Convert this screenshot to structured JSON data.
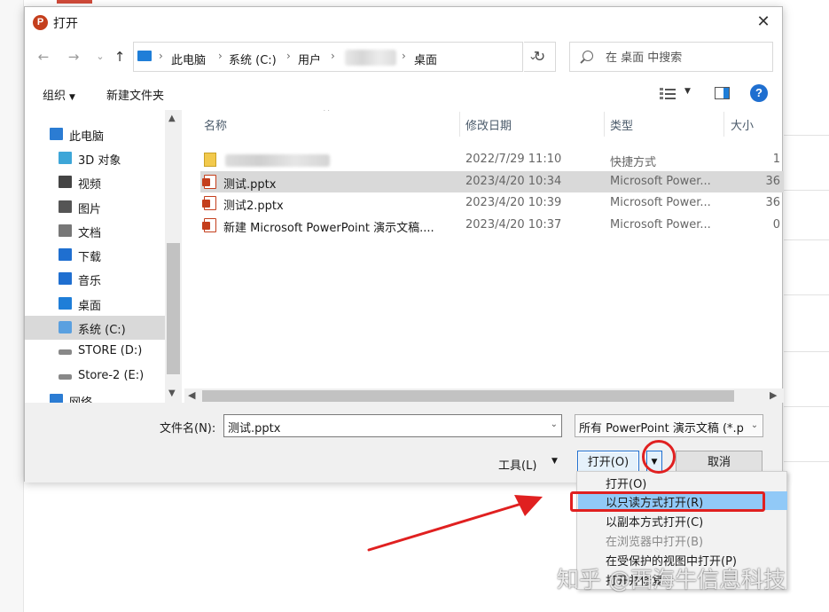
{
  "dialog": {
    "title": "打开",
    "app_icon_letter": "P",
    "close_glyph": "✕"
  },
  "nav_buttons": {
    "back": "←",
    "forward": "→",
    "recent": "⌄",
    "up": "↑"
  },
  "breadcrumb": [
    "此电脑",
    "系统 (C:)",
    "用户",
    "桌面"
  ],
  "search": {
    "placeholder": "在 桌面 中搜索"
  },
  "toolbar": {
    "organize": "组织",
    "new_folder": "新建文件夹",
    "help": "?"
  },
  "nav_pane": {
    "items": [
      {
        "label": "此电脑",
        "icon": "pc-icon",
        "color": "#2b7cd3"
      },
      {
        "label": "3D 对象",
        "icon": "cube-icon",
        "color": "#3da6d8"
      },
      {
        "label": "视频",
        "icon": "video-icon",
        "color": "#444444"
      },
      {
        "label": "图片",
        "icon": "picture-icon",
        "color": "#555555"
      },
      {
        "label": "文档",
        "icon": "document-icon",
        "color": "#777777"
      },
      {
        "label": "下载",
        "icon": "download-icon",
        "color": "#1f6fd0"
      },
      {
        "label": "音乐",
        "icon": "music-icon",
        "color": "#1f6fd0"
      },
      {
        "label": "桌面",
        "icon": "desktop-icon",
        "color": "#1f7ed8"
      },
      {
        "label": "系统 (C:)",
        "icon": "drive-c-icon",
        "color": "#5aa0e0"
      },
      {
        "label": "STORE (D:)",
        "icon": "drive-icon",
        "color": "#888888"
      },
      {
        "label": "Store-2 (E:)",
        "icon": "drive-icon",
        "color": "#888888"
      },
      {
        "label": "网络",
        "icon": "network-icon",
        "color": "#2b7cd3"
      }
    ],
    "selected": "系统 (C:)"
  },
  "file_list": {
    "columns": [
      "名称",
      "修改日期",
      "类型",
      "大小"
    ],
    "rows": [
      {
        "name": "",
        "date": "2022/7/29 11:10",
        "type": "快捷方式",
        "size": "1",
        "icon": "shortcut-icon",
        "selected": false
      },
      {
        "name": "测试.pptx",
        "date": "2023/4/20 10:34",
        "type": "Microsoft Power...",
        "size": "36",
        "icon": "ppt-icon",
        "selected": true
      },
      {
        "name": "测试2.pptx",
        "date": "2023/4/20 10:39",
        "type": "Microsoft Power...",
        "size": "36",
        "icon": "ppt-icon",
        "selected": false
      },
      {
        "name": "新建 Microsoft PowerPoint 演示文稿....",
        "date": "2023/4/20 10:37",
        "type": "Microsoft Power...",
        "size": "0",
        "icon": "ppt-icon",
        "selected": false
      }
    ]
  },
  "bottom": {
    "filename_label": "文件名(N):",
    "filename_value": "测试.pptx",
    "filter_value": "所有 PowerPoint 演示文稿 (*.p",
    "tools": "工具(L)",
    "open": "打开(O)",
    "cancel": "取消"
  },
  "open_menu": {
    "items": [
      {
        "label": "打开(O)",
        "enabled": true,
        "highlighted": false
      },
      {
        "label": "以只读方式打开(R)",
        "enabled": true,
        "highlighted": true
      },
      {
        "label": "以副本方式打开(C)",
        "enabled": true,
        "highlighted": false
      },
      {
        "label": "在浏览器中打开(B)",
        "enabled": false,
        "highlighted": false
      },
      {
        "label": "在受保护的视图中打开(P)",
        "enabled": true,
        "highlighted": false
      },
      {
        "label": "打开并修复",
        "enabled": true,
        "highlighted": false
      }
    ]
  },
  "watermark": "知乎 @西海牛信息科技",
  "colors": {
    "annotation": "#e02020",
    "accent": "#1f6fd0",
    "menu_highlight": "#91c9f7",
    "selection": "#d9d9d9"
  }
}
